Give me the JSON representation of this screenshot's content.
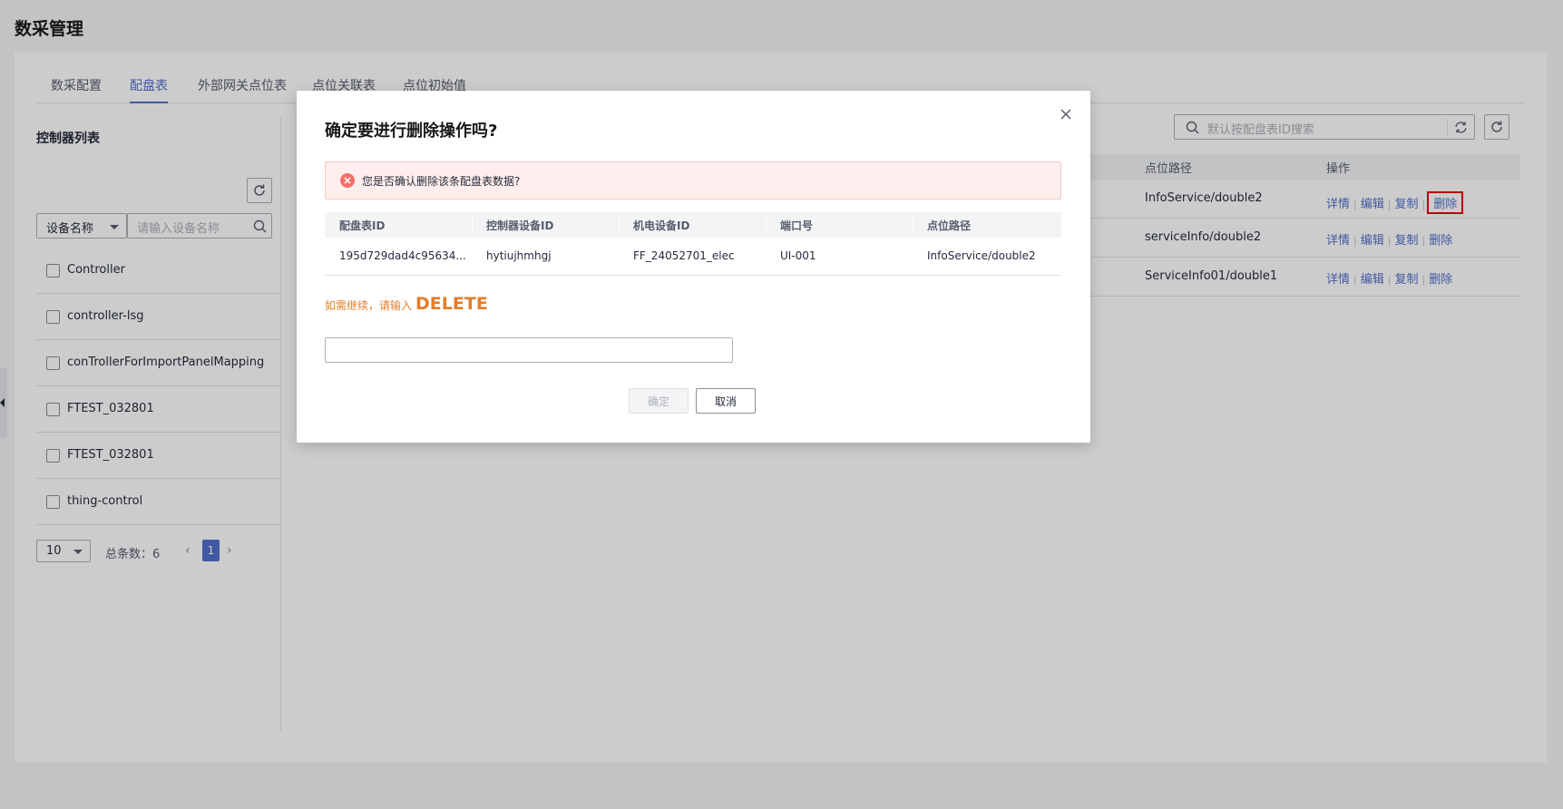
{
  "page": {
    "title": "数采管理"
  },
  "tabs": [
    {
      "label": "数采配置"
    },
    {
      "label": "配盘表"
    },
    {
      "label": "外部网关点位表"
    },
    {
      "label": "点位关联表"
    },
    {
      "label": "点位初始值"
    }
  ],
  "sidebar": {
    "title": "控制器列表",
    "filter_select": "设备名称",
    "search_placeholder": "请输入设备名称",
    "items": [
      {
        "label": "Controller"
      },
      {
        "label": "controller-lsg"
      },
      {
        "label": "conTrollerForImportPanelMapping"
      },
      {
        "label": "FTEST_032801"
      },
      {
        "label": "FTEST_032801"
      },
      {
        "label": "thing-control"
      }
    ],
    "pager": {
      "page_size": "10",
      "total_text": "总条数：6",
      "current_page": "1"
    }
  },
  "main": {
    "search_placeholder": "默认按配盘表ID搜索",
    "columns": {
      "path": "点位路径",
      "ops": "操作"
    },
    "rows": [
      {
        "path": "InfoService/double2"
      },
      {
        "path": "serviceInfo/double2"
      },
      {
        "path": "ServiceInfo01/double1"
      }
    ],
    "ops": {
      "detail": "详情",
      "edit": "编辑",
      "copy": "复制",
      "delete": "删除"
    }
  },
  "modal": {
    "title": "确定要进行删除操作吗?",
    "alert_text": "您是否确认删除该条配盘表数据?",
    "table": {
      "headers": [
        "配盘表ID",
        "控制器设备ID",
        "机电设备ID",
        "端口号",
        "点位路径"
      ],
      "row": [
        "195d729dad4c95634...",
        "hytiujhmhgj",
        "FF_24052701_elec",
        "UI-001",
        "InfoService/double2"
      ]
    },
    "prompt_text": "如需继续，请输入",
    "prompt_keyword": "DELETE",
    "input_value": "",
    "confirm_label": "确定",
    "cancel_label": "取消"
  },
  "colors": {
    "accent": "#526ecc",
    "danger": "#e60012",
    "warning_text": "#e37d29",
    "alert_bg": "#ffeeed"
  }
}
